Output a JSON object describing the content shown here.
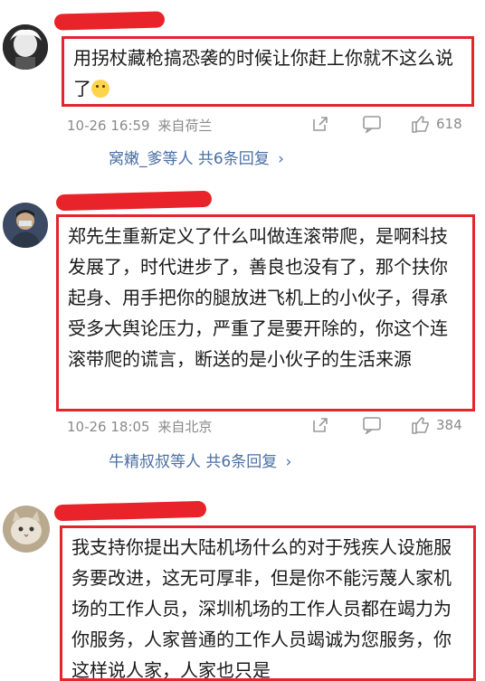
{
  "comments": [
    {
      "text": "用拐杖藏枪搞恐袭的时候让你赶上你就不这么说了",
      "emoji": "face-with-tears-icon",
      "time": "10-26 16:59",
      "source": "来自荷兰",
      "likes": "618",
      "replies": "窝嫩_爹等人 共6条回复"
    },
    {
      "text": "郑先生重新定义了什么叫做连滚带爬，是啊科技发展了，时代进步了，善良也没有了，那个扶你起身、用手把你的腿放进飞机上的小伙子，得承受多大舆论压力，严重了是要开除的，你这个连滚带爬的谎言，断送的是小伙子的生活来源",
      "time": "10-26 18:05",
      "source": "来自北京",
      "likes": "384",
      "replies": "牛精叔叔等人 共6条回复"
    },
    {
      "text": "我支持你提出大陆机场什么的对于残疾人设施服务要改进，这无可厚非，但是你不能污蔑人家机场的工作人员，深圳机场的工作人员都在竭力为你服务，人家普通的工作人员竭诚为您服务，你这样说人家，人家也只是"
    }
  ],
  "colors": {
    "highlight": "#e3262e",
    "redact": "#e8232a",
    "link": "#4a6fa5",
    "meta": "#8a8a8a"
  },
  "icons": {
    "share": "share-icon",
    "comment": "comment-icon",
    "like": "thumbs-up-icon",
    "chevron": "chevron-right-icon"
  }
}
